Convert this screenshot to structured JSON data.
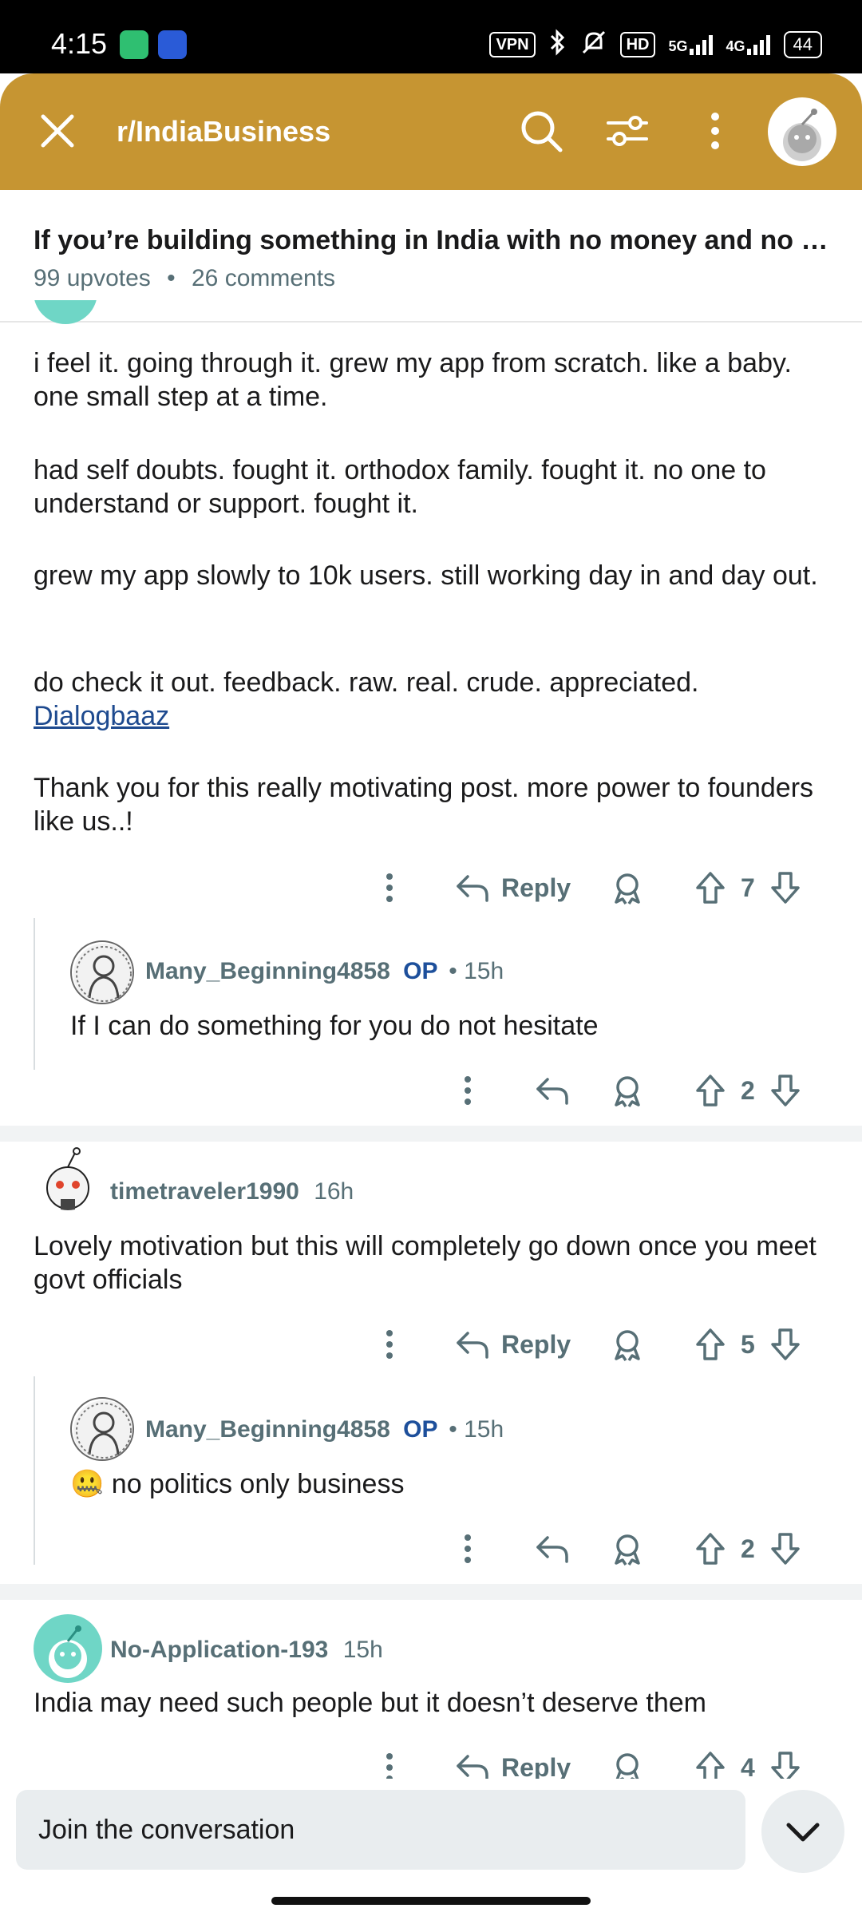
{
  "status_bar": {
    "time": "4:15",
    "vpn": "VPN",
    "hd": "HD",
    "net1": "5G",
    "net2": "4G",
    "battery": "44"
  },
  "app_bar": {
    "title": "r/IndiaBusiness",
    "color": "#c69532"
  },
  "post": {
    "title": "If you’re building something in India with no money and no s…",
    "upvotes": "99 upvotes",
    "dot": "•",
    "comments": "26 comments"
  },
  "comment1": {
    "para1": "i feel it. going through it. grew my app from scratch. like a baby. one small step at a time.",
    "para2": "had self doubts. fought it. orthodox family. fought it. no one to understand or support. fought it.",
    "para3": "grew my app slowly to 10k users. still working day in and day out.",
    "para4": "do check it out. feedback. raw. real. crude. appreciated.",
    "link": "Dialogbaaz",
    "para5": "Thank you for this really motivating post. more power to founders like us..!",
    "reply_label": "Reply",
    "votes": "7"
  },
  "reply1": {
    "user": "Many_Beginning4858",
    "op": "OP",
    "meta": "• 15h",
    "text": "If I can do something for you do not hesitate",
    "votes": "2"
  },
  "comment2": {
    "user": "timetraveler1990",
    "age": "16h",
    "text": "Lovely motivation but this will completely go down once you meet govt officials",
    "reply_label": "Reply",
    "votes": "5"
  },
  "reply2": {
    "user": "Many_Beginning4858",
    "op": "OP",
    "meta": "• 15h",
    "emoji": "🤐",
    "text": "no politics only business",
    "votes": "2"
  },
  "comment3": {
    "user": "No-Application-193",
    "age": "15h",
    "text": "India may need such people but it doesn’t deserve them",
    "reply_label": "Reply",
    "votes": "4"
  },
  "bottom": {
    "placeholder": "Join the conversation"
  }
}
